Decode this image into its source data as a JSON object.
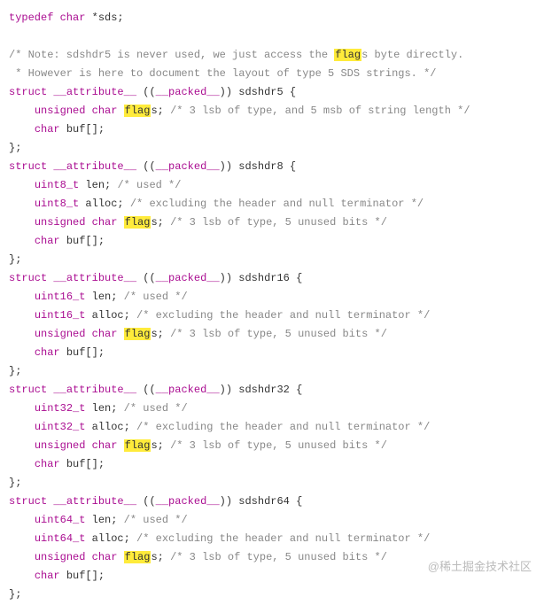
{
  "code": {
    "lines": [
      [
        {
          "t": "typedef char ",
          "c": "kw"
        },
        {
          "t": "*sds;"
        }
      ],
      [],
      [
        {
          "t": "/* Note: sdshdr5 is never used, we just access the ",
          "c": "com"
        },
        {
          "t": "flag",
          "c": "hl"
        },
        {
          "t": "s byte directly.",
          "c": "com"
        }
      ],
      [
        {
          "t": " * However is here to document the layout of type 5 SDS strings. */",
          "c": "com"
        }
      ],
      [
        {
          "t": "struct ",
          "c": "kw"
        },
        {
          "t": "__attribute__",
          "c": "attr"
        },
        {
          "t": " (("
        },
        {
          "t": "__packed__",
          "c": "attr"
        },
        {
          "t": ")) sdshdr5 {"
        }
      ],
      [
        {
          "t": "    "
        },
        {
          "t": "unsigned char ",
          "c": "kw"
        },
        {
          "t": "flag",
          "c": "hl"
        },
        {
          "t": "s; "
        },
        {
          "t": "/* 3 lsb of type, and 5 msb of string length */",
          "c": "com"
        }
      ],
      [
        {
          "t": "    "
        },
        {
          "t": "char ",
          "c": "kw"
        },
        {
          "t": "buf[];"
        }
      ],
      [
        {
          "t": "};"
        }
      ],
      [
        {
          "t": "struct ",
          "c": "kw"
        },
        {
          "t": "__attribute__",
          "c": "attr"
        },
        {
          "t": " (("
        },
        {
          "t": "__packed__",
          "c": "attr"
        },
        {
          "t": ")) sdshdr8 {"
        }
      ],
      [
        {
          "t": "    "
        },
        {
          "t": "uint8_t ",
          "c": "kw"
        },
        {
          "t": "len; "
        },
        {
          "t": "/* used */",
          "c": "com"
        }
      ],
      [
        {
          "t": "    "
        },
        {
          "t": "uint8_t ",
          "c": "kw"
        },
        {
          "t": "alloc; "
        },
        {
          "t": "/* excluding the header and null terminator */",
          "c": "com"
        }
      ],
      [
        {
          "t": "    "
        },
        {
          "t": "unsigned char ",
          "c": "kw"
        },
        {
          "t": "flag",
          "c": "hl"
        },
        {
          "t": "s; "
        },
        {
          "t": "/* 3 lsb of type, 5 unused bits */",
          "c": "com"
        }
      ],
      [
        {
          "t": "    "
        },
        {
          "t": "char ",
          "c": "kw"
        },
        {
          "t": "buf[];"
        }
      ],
      [
        {
          "t": "};"
        }
      ],
      [
        {
          "t": "struct ",
          "c": "kw"
        },
        {
          "t": "__attribute__",
          "c": "attr"
        },
        {
          "t": " (("
        },
        {
          "t": "__packed__",
          "c": "attr"
        },
        {
          "t": ")) sdshdr16 {"
        }
      ],
      [
        {
          "t": "    "
        },
        {
          "t": "uint16_t ",
          "c": "kw"
        },
        {
          "t": "len; "
        },
        {
          "t": "/* used */",
          "c": "com"
        }
      ],
      [
        {
          "t": "    "
        },
        {
          "t": "uint16_t ",
          "c": "kw"
        },
        {
          "t": "alloc; "
        },
        {
          "t": "/* excluding the header and null terminator */",
          "c": "com"
        }
      ],
      [
        {
          "t": "    "
        },
        {
          "t": "unsigned char ",
          "c": "kw"
        },
        {
          "t": "flag",
          "c": "hl"
        },
        {
          "t": "s; "
        },
        {
          "t": "/* 3 lsb of type, 5 unused bits */",
          "c": "com"
        }
      ],
      [
        {
          "t": "    "
        },
        {
          "t": "char ",
          "c": "kw"
        },
        {
          "t": "buf[];"
        }
      ],
      [
        {
          "t": "};"
        }
      ],
      [
        {
          "t": "struct ",
          "c": "kw"
        },
        {
          "t": "__attribute__",
          "c": "attr"
        },
        {
          "t": " (("
        },
        {
          "t": "__packed__",
          "c": "attr"
        },
        {
          "t": ")) sdshdr32 {"
        }
      ],
      [
        {
          "t": "    "
        },
        {
          "t": "uint32_t ",
          "c": "kw"
        },
        {
          "t": "len; "
        },
        {
          "t": "/* used */",
          "c": "com"
        }
      ],
      [
        {
          "t": "    "
        },
        {
          "t": "uint32_t ",
          "c": "kw"
        },
        {
          "t": "alloc; "
        },
        {
          "t": "/* excluding the header and null terminator */",
          "c": "com"
        }
      ],
      [
        {
          "t": "    "
        },
        {
          "t": "unsigned char ",
          "c": "kw"
        },
        {
          "t": "flag",
          "c": "hl"
        },
        {
          "t": "s; "
        },
        {
          "t": "/* 3 lsb of type, 5 unused bits */",
          "c": "com"
        }
      ],
      [
        {
          "t": "    "
        },
        {
          "t": "char ",
          "c": "kw"
        },
        {
          "t": "buf[];"
        }
      ],
      [
        {
          "t": "};"
        }
      ],
      [
        {
          "t": "struct ",
          "c": "kw"
        },
        {
          "t": "__attribute__",
          "c": "attr"
        },
        {
          "t": " (("
        },
        {
          "t": "__packed__",
          "c": "attr"
        },
        {
          "t": ")) sdshdr64 {"
        }
      ],
      [
        {
          "t": "    "
        },
        {
          "t": "uint64_t ",
          "c": "kw"
        },
        {
          "t": "len; "
        },
        {
          "t": "/* used */",
          "c": "com"
        }
      ],
      [
        {
          "t": "    "
        },
        {
          "t": "uint64_t ",
          "c": "kw"
        },
        {
          "t": "alloc; "
        },
        {
          "t": "/* excluding the header and null terminator */",
          "c": "com"
        }
      ],
      [
        {
          "t": "    "
        },
        {
          "t": "unsigned char ",
          "c": "kw"
        },
        {
          "t": "flag",
          "c": "hl"
        },
        {
          "t": "s; "
        },
        {
          "t": "/* 3 lsb of type, 5 unused bits */",
          "c": "com"
        }
      ],
      [
        {
          "t": "    "
        },
        {
          "t": "char ",
          "c": "kw"
        },
        {
          "t": "buf[];"
        }
      ],
      [
        {
          "t": "};"
        }
      ]
    ]
  },
  "watermark": "@稀土掘金技术社区"
}
